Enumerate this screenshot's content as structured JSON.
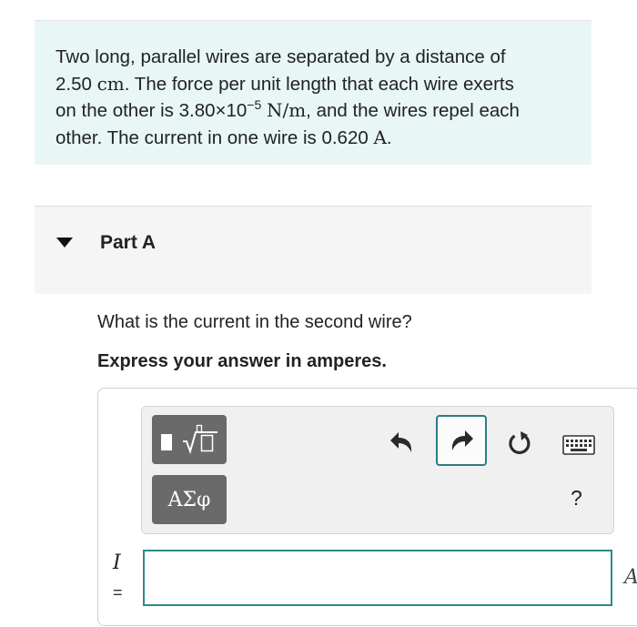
{
  "problem": {
    "t1": "Two long, parallel wires are separated by a distance of",
    "t2": "2.50",
    "t3": "cm",
    "t4": ". The force per unit length that each wire exerts",
    "t5": "on the other is 3.80×10",
    "t6": "−5",
    "t7": "N/m",
    "t8": ", and the wires repel each",
    "t9": "other. The current in one wire is 0.620",
    "t10": "A",
    "t11": "."
  },
  "part": {
    "title": "Part A"
  },
  "question": "What is the current in the second wire?",
  "instruction": "Express your answer in amperes.",
  "toolbar": {
    "symbols_label": "ΑΣφ",
    "help_label": "?",
    "icons": [
      "templates-icon",
      "undo-icon",
      "redo-icon",
      "reset-icon",
      "keyboard-icon"
    ],
    "accent_color": "#2b7c84"
  },
  "answer": {
    "variable": "I",
    "equals": "=",
    "value": "",
    "unit": "A"
  }
}
